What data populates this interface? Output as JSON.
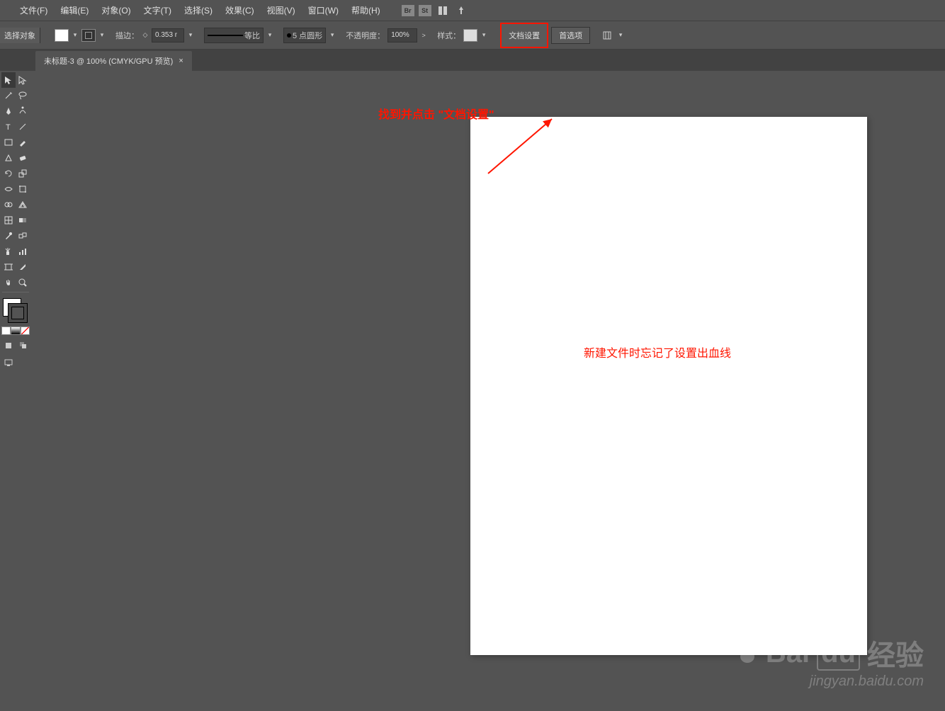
{
  "menu": {
    "file": "文件(F)",
    "edit": "编辑(E)",
    "object": "对象(O)",
    "type": "文字(T)",
    "select": "选择(S)",
    "effect": "效果(C)",
    "view": "视图(V)",
    "window": "窗口(W)",
    "help": "帮助(H)",
    "br": "Br",
    "st": "St"
  },
  "control": {
    "noSelection": "选择对象",
    "strokeLabel": "描边：",
    "strokeWeight": "0.353 r",
    "profileLabel": "等比",
    "brushLabel": "5 点圆形",
    "opacityLabel": "不透明度：",
    "opacityValue": "100%",
    "styleLabel": "样式：",
    "docSetup": "文档设置",
    "prefs": "首选项"
  },
  "tab": {
    "title": "未标题-3 @ 100% (CMYK/GPU 预览)",
    "close": "×"
  },
  "annotations": {
    "a1": "找到并点击 \"文档设置\"",
    "a2": "新建文件时忘记了设置出血线"
  },
  "watermark": {
    "main1": "Bai",
    "main2": "du",
    "brand": "经验",
    "sub": "jingyan.baidu.com"
  }
}
